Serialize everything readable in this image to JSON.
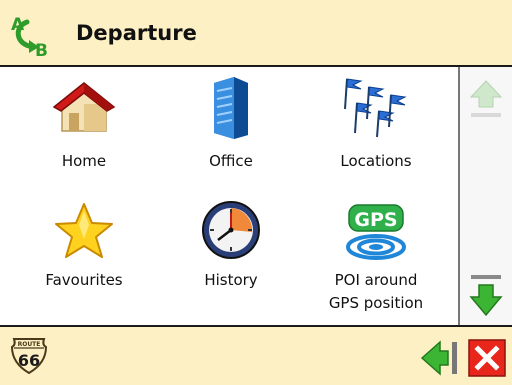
{
  "header": {
    "title": "Departure",
    "logo_icon": "route-a-to-b-icon"
  },
  "tiles": [
    {
      "label": "Home",
      "icon": "home-icon"
    },
    {
      "label": "Office",
      "icon": "office-building-icon"
    },
    {
      "label": "Locations",
      "icon": "flags-icon"
    },
    {
      "label": "Favourites",
      "icon": "star-icon"
    },
    {
      "label": "History",
      "icon": "clock-icon"
    },
    {
      "label_line1": "POI around",
      "label_line2": "GPS position",
      "icon": "gps-icon"
    }
  ],
  "gps_icon_text": "GPS",
  "scroll": {
    "up_enabled": false,
    "down_enabled": true
  },
  "footer": {
    "route_badge_top": "ROUTE",
    "route_badge_number": "66"
  },
  "colors": {
    "header_bg": "#fdf0c4",
    "arrow_green": "#3db534",
    "close_red": "#e8261c"
  }
}
